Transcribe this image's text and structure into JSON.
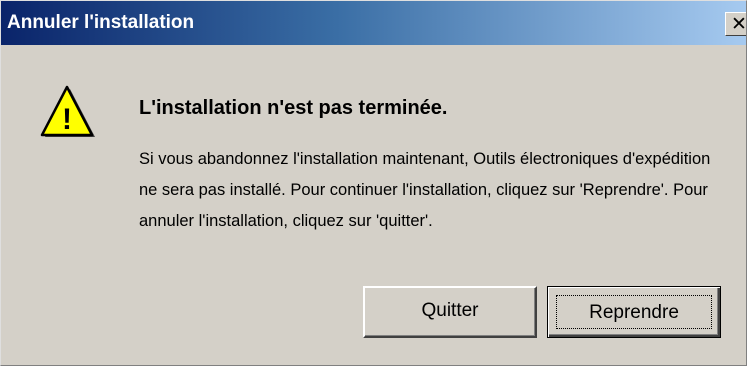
{
  "window": {
    "title": "Annuler l'installation",
    "close_glyph": "✕"
  },
  "icon": {
    "name": "warning-icon",
    "glyph": "!"
  },
  "content": {
    "heading": "L'installation n'est pas terminée.",
    "message": "Si vous abandonnez l'installation maintenant, Outils électroniques d'expédition ne sera pas installé. Pour continuer l'installation, cliquez sur 'Reprendre'. Pour annuler l'installation, cliquez sur 'quitter'."
  },
  "buttons": {
    "quit_label": "Quitter",
    "resume_label": "Reprendre"
  },
  "colors": {
    "dialog_bg": "#d4d0c8",
    "titlebar_start": "#0a246a",
    "titlebar_end": "#a6caf0",
    "warning_fill": "#ffff00"
  }
}
